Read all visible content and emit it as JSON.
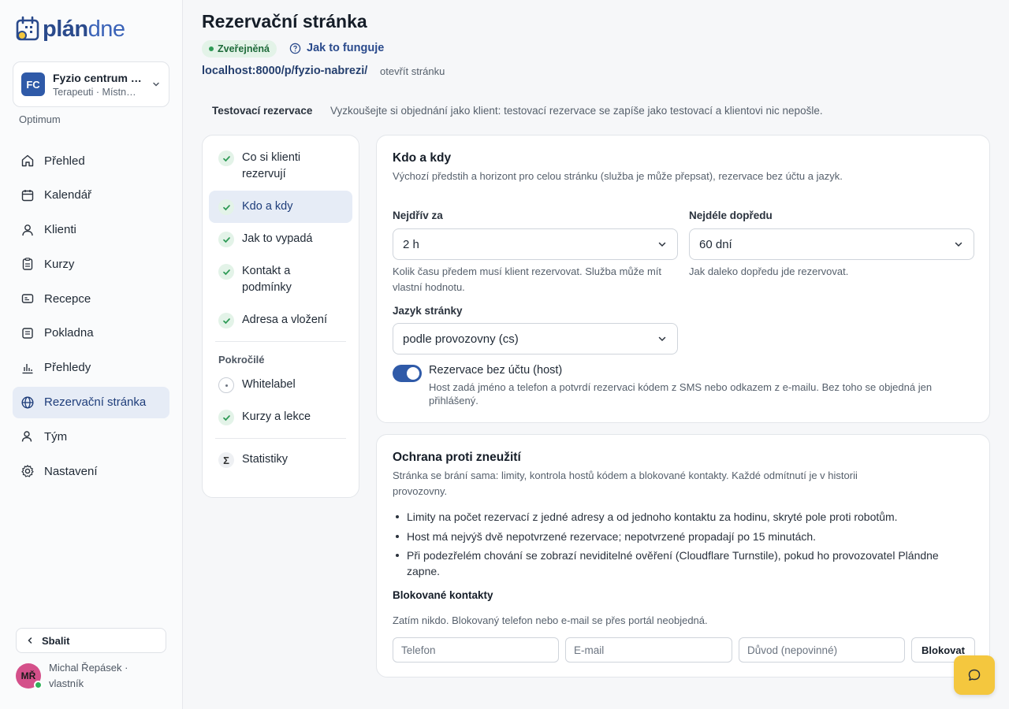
{
  "brand": {
    "name_bold": "plán",
    "name_light": "dne",
    "accent": "#2f5aa8"
  },
  "workspace": {
    "initials": "FC",
    "name": "Fyzio centrum …",
    "subtitle": "Terapeuti · Místn…",
    "plan": "Optimum"
  },
  "nav": [
    {
      "id": "prehled",
      "label": "Přehled",
      "icon": "home-icon",
      "active": false
    },
    {
      "id": "kalendar",
      "label": "Kalendář",
      "icon": "calendar-icon",
      "active": false
    },
    {
      "id": "klienti",
      "label": "Klienti",
      "icon": "user-icon",
      "active": false
    },
    {
      "id": "kurzy",
      "label": "Kurzy",
      "icon": "clipboard-icon",
      "active": false
    },
    {
      "id": "recepce",
      "label": "Recepce",
      "icon": "card-icon",
      "active": false
    },
    {
      "id": "pokladna",
      "label": "Pokladna",
      "icon": "receipt-icon",
      "active": false
    },
    {
      "id": "prehledy",
      "label": "Přehledy",
      "icon": "bar-chart-icon",
      "active": false
    },
    {
      "id": "rezervacni",
      "label": "Rezervační stránka",
      "icon": "globe-icon",
      "active": true
    },
    {
      "id": "tym",
      "label": "Tým",
      "icon": "team-icon",
      "active": false
    },
    {
      "id": "nastaveni",
      "label": "Nastavení",
      "icon": "gear-icon",
      "active": false
    }
  ],
  "sidebar_footer": {
    "collapse_label": "Sbalit",
    "user_initials": "MŘ",
    "user_name": "Michal Řepásek · vlastník"
  },
  "page": {
    "title": "Rezervační stránka",
    "status": "Zveřejněná",
    "howto": "Jak to funguje",
    "url": "localhost:8000/p/fyzio-nabrezi/",
    "open_link": "otevřít stránku",
    "test_label": "Testovací rezervace",
    "test_desc": "Vyzkoušejte si objednání jako klient: testovací rezervace se zapíše jako testovací a klientovi nic nepošle."
  },
  "steps": {
    "items": [
      {
        "label": "Co si klienti rezervují",
        "state": "done"
      },
      {
        "label": "Kdo a kdy",
        "state": "done",
        "active": true
      },
      {
        "label": "Jak to vypadá",
        "state": "done"
      },
      {
        "label": "Kontakt a podmínky",
        "state": "done"
      },
      {
        "label": "Adresa a vložení",
        "state": "done"
      }
    ],
    "advanced_label": "Pokročilé",
    "advanced": [
      {
        "label": "Whitelabel",
        "state": "empty"
      },
      {
        "label": "Kurzy a lekce",
        "state": "done"
      }
    ],
    "stats": {
      "label": "Statistiky",
      "icon": "sigma-icon"
    }
  },
  "who_when": {
    "title": "Kdo a kdy",
    "desc": "Výchozí předstih a horizont pro celou stránku (služba je může přepsat), rezervace bez účtu a jazyk.",
    "earliest_label": "Nejdřív za",
    "earliest_value": "2 h",
    "earliest_hint": "Kolik času předem musí klient rezervovat. Služba může mít vlastní hodnotu.",
    "latest_label": "Nejdéle dopředu",
    "latest_value": "60 dní",
    "latest_hint": "Jak daleko dopředu jde rezervovat.",
    "lang_label": "Jazyk stránky",
    "lang_value": "podle provozovny (cs)",
    "guest_label": "Rezervace bez účtu (host)",
    "guest_on": true,
    "guest_desc": "Host zadá jméno a telefon a potvrdí rezervaci kódem z SMS nebo odkazem z e-mailu. Bez toho se objedná jen přihlášený."
  },
  "abuse": {
    "title": "Ochrana proti zneužití",
    "desc": "Stránka se brání sama: limity, kontrola hostů kódem a blokované kontakty. Každé odmítnutí je v historii provozovny.",
    "bullets": [
      "Limity na počet rezervací z jedné adresy a od jednoho kontaktu za hodinu, skryté pole proti robotům.",
      "Host má nejvýš dvě nepotvrzené rezervace; nepotvrzené propadají po 15 minutách.",
      "Při podezřelém chování se zobrazí neviditelné ověření (Cloudflare Turnstile), pokud ho provozovatel Plándne zapne."
    ],
    "blocked_title": "Blokované kontakty",
    "blocked_empty": "Zatím nikdo. Blokovaný telefon nebo e-mail se přes portál neobjedná.",
    "phone_placeholder": "Telefon",
    "email_placeholder": "E-mail",
    "reason_placeholder": "Důvod (nepovinné)",
    "block_button": "Blokovat"
  }
}
